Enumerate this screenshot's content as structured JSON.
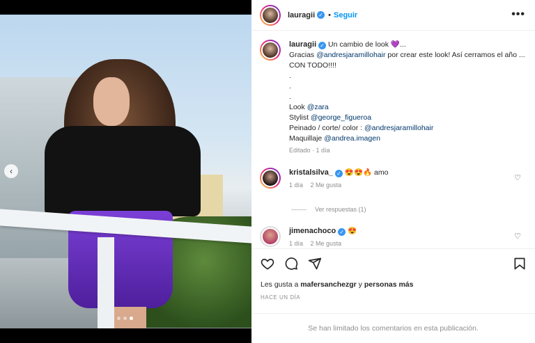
{
  "header": {
    "username": "lauragii",
    "separator": "•",
    "follow_label": "Seguir",
    "more_label": "•••"
  },
  "caption": {
    "username": "lauragii",
    "title": "Un cambio de look 💜...",
    "line1_pre": "Gracias ",
    "line1_mention": "@andresjaramillohair",
    "line1_post": " por crear este look! Así cerramos el año ... CON TODO!!!!",
    "dot1": ".",
    "dot2": ".",
    "dot3": ".",
    "look_label": "Look ",
    "look_mention": "@zara",
    "stylist_label": "Stylist ",
    "stylist_mention": "@george_figueroa",
    "peinado_label": "Peinado / corte/ color : ",
    "peinado_mention": "@andresjaramillohair",
    "maquillaje_label": "Maquillaje ",
    "maquillaje_mention": "@andrea.imagen",
    "edited": "Editado · 1 día"
  },
  "comments": [
    {
      "username": "kristalsilva_",
      "text": "😍😍🔥 amo",
      "time": "1 día",
      "likes": "2 Me gusta"
    },
    {
      "username": "jimenachoco",
      "text": "😍",
      "time": "1 día",
      "likes": "2 Me gusta"
    }
  ],
  "replies_label": "Ver respuestas (1)",
  "likes": {
    "prefix": "Les gusta a ",
    "user": "mafersanchezgr",
    "middle": " y ",
    "others": "personas más"
  },
  "posted_ago": "HACE UN DÍA",
  "comments_limited": "Se han limitado los comentarios en esta publicación.",
  "carousel": {
    "prev_icon": "‹",
    "current_index": 3,
    "total": 3
  },
  "icons": {
    "heart": "heart-icon",
    "comment": "comment-icon",
    "share": "share-icon",
    "save": "bookmark-icon"
  },
  "colors": {
    "link": "#00376b",
    "follow": "#0095f6",
    "verified": "#3897f0",
    "muted": "#8e8e8e"
  }
}
